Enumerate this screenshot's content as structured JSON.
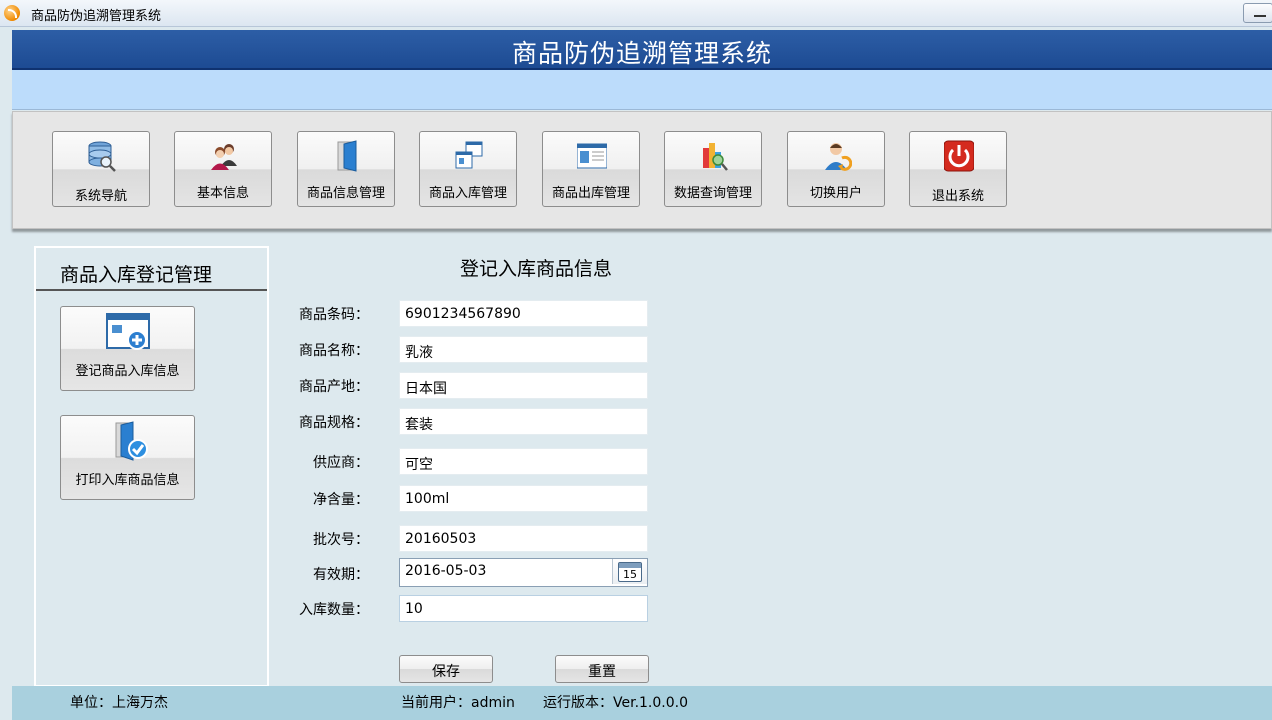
{
  "window": {
    "title": "商品防伪追溯管理系统"
  },
  "header": {
    "title": "商品防伪追溯管理系统"
  },
  "toolbar": {
    "items": [
      {
        "label": "系统导航",
        "icon": "database-search-icon"
      },
      {
        "label": "基本信息",
        "icon": "users-icon"
      },
      {
        "label": "商品信息管理",
        "icon": "folder-icon"
      },
      {
        "label": "商品入库管理",
        "icon": "windows-icon"
      },
      {
        "label": "商品出库管理",
        "icon": "window-list-icon"
      },
      {
        "label": "数据查询管理",
        "icon": "chart-search-icon"
      },
      {
        "label": "切换用户",
        "icon": "switch-user-icon"
      },
      {
        "label": "退出系统",
        "icon": "power-icon"
      }
    ]
  },
  "sidebar": {
    "heading": "商品入库登记管理",
    "buttons": [
      {
        "label": "登记商品入库信息",
        "icon": "add-window-icon"
      },
      {
        "label": "打印入库商品信息",
        "icon": "folder-check-icon"
      }
    ]
  },
  "form": {
    "title": "登记入库商品信息",
    "fields": [
      {
        "label": "商品条码：",
        "value": "6901234567890"
      },
      {
        "label": "商品名称：",
        "value": "乳液"
      },
      {
        "label": "商品产地：",
        "value": "日本国"
      },
      {
        "label": "商品规格：",
        "value": "套装"
      },
      {
        "label": "供应商：",
        "value": "可空"
      },
      {
        "label": "净含量：",
        "value": "100ml"
      },
      {
        "label": "批次号：",
        "value": "20160503"
      },
      {
        "label": "有效期：",
        "value": "2016-05-03",
        "calendar_day": "15"
      },
      {
        "label": "入库数量：",
        "value": "10"
      }
    ],
    "save_label": "保存",
    "reset_label": "重置"
  },
  "status": {
    "unit": "单位：上海万杰",
    "current_user": "当前用户：admin",
    "version": "运行版本：Ver.1.0.0.0"
  }
}
